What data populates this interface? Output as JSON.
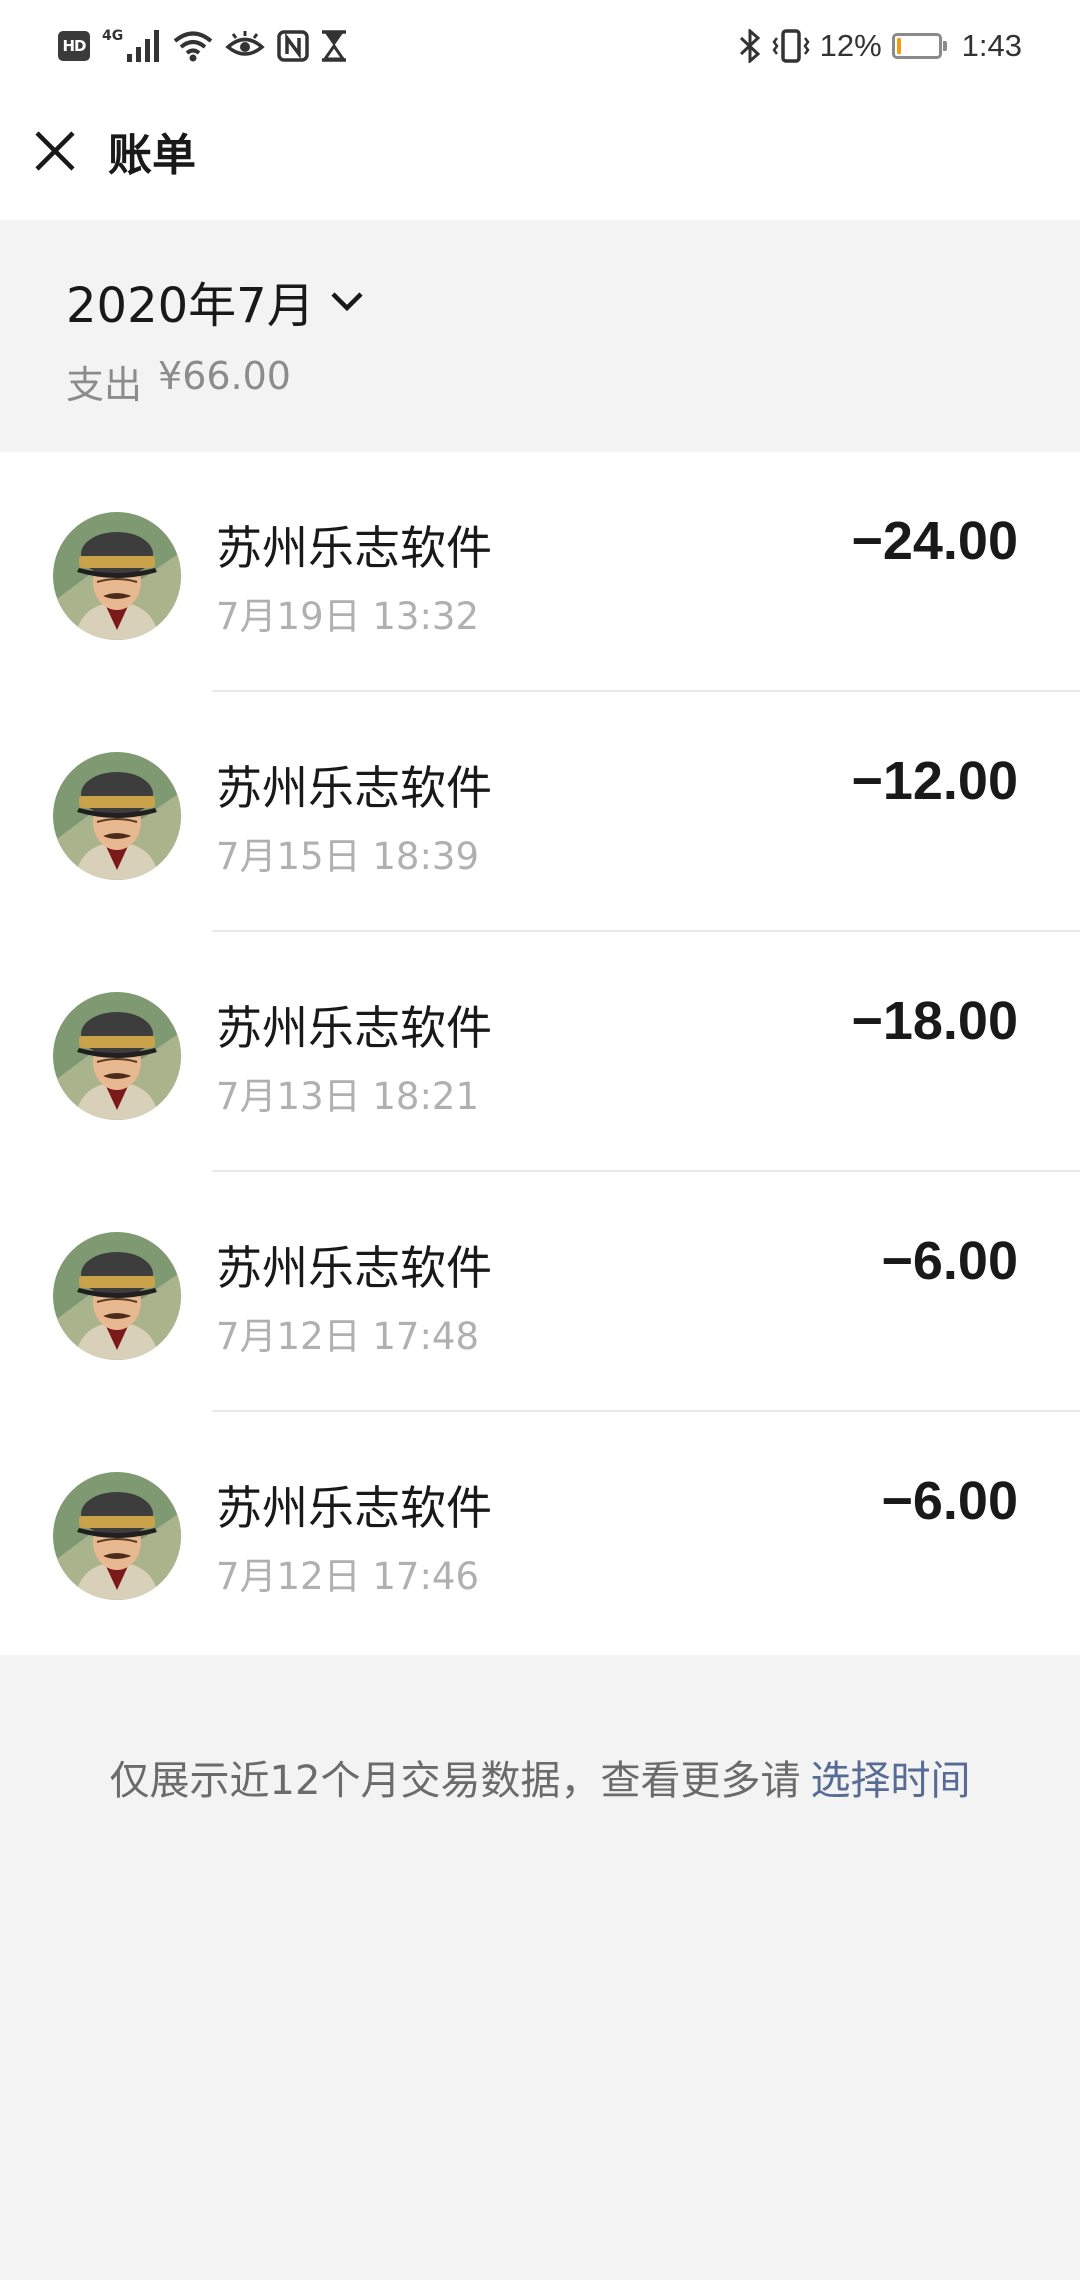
{
  "status_bar": {
    "hd": "HD",
    "network": "4G",
    "battery_percent": "12%",
    "battery_level": 0.12,
    "time": "1:43"
  },
  "header": {
    "title": "账单"
  },
  "summary": {
    "month": "2020年7月",
    "expense_label": "支出",
    "expense_value": "¥66.00"
  },
  "transactions": [
    {
      "merchant": "苏州乐志软件",
      "time": "7月19日 13:32",
      "amount": "−24.00"
    },
    {
      "merchant": "苏州乐志软件",
      "time": "7月15日 18:39",
      "amount": "−12.00"
    },
    {
      "merchant": "苏州乐志软件",
      "time": "7月13日 18:21",
      "amount": "−18.00"
    },
    {
      "merchant": "苏州乐志软件",
      "time": "7月12日 17:48",
      "amount": "−6.00"
    },
    {
      "merchant": "苏州乐志软件",
      "time": "7月12日 17:46",
      "amount": "−6.00"
    }
  ],
  "footer": {
    "note": "仅展示近12个月交易数据，查看更多请",
    "link": "选择时间"
  },
  "colors": {
    "background": "#f3f3f3",
    "link": "#576b95",
    "battery": "#f39c12"
  }
}
